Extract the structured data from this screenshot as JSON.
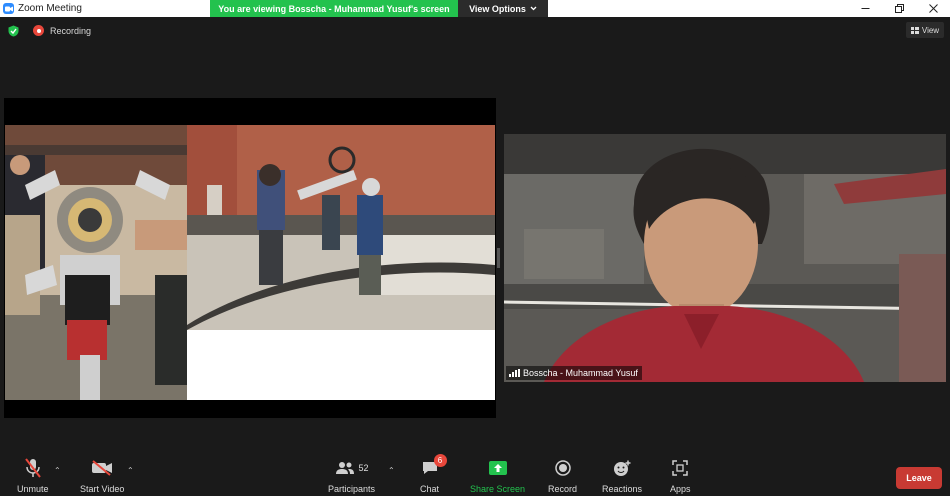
{
  "window": {
    "title": "Zoom Meeting"
  },
  "banner": {
    "text": "You are viewing Bosscha - Muhammad Yusuf's screen",
    "view_options": "View Options"
  },
  "meeting": {
    "recording_label": "Recording",
    "view_label": "View"
  },
  "video": {
    "participant_name": "Bosscha - Muhammad Yusuf"
  },
  "toolbar": {
    "unmute": "Unmute",
    "start_video": "Start Video",
    "participants": "Participants",
    "participants_count": "52",
    "chat": "Chat",
    "chat_badge": "6",
    "share_screen": "Share Screen",
    "record": "Record",
    "reactions": "Reactions",
    "apps": "Apps",
    "leave": "Leave"
  },
  "colors": {
    "accent_green": "#23c24e",
    "leave_red": "#c83a33",
    "zoom_blue": "#2d8cff",
    "badge_red": "#e8473b"
  }
}
